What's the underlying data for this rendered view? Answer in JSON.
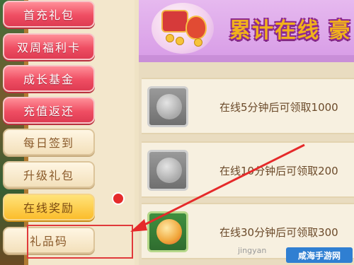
{
  "menu": {
    "items": [
      {
        "label": "首充礼包",
        "style": "pink"
      },
      {
        "label": "双周福利卡",
        "style": "pink"
      },
      {
        "label": "成长基金",
        "style": "pink"
      },
      {
        "label": "充值返还",
        "style": "pink"
      },
      {
        "label": "每日签到",
        "style": "beige"
      },
      {
        "label": "升级礼包",
        "style": "beige"
      },
      {
        "label": "在线奖励",
        "style": "yellow"
      },
      {
        "label": "礼品码",
        "style": "beige"
      }
    ]
  },
  "banner": {
    "title": "累计在线 豪"
  },
  "rewards": [
    {
      "text": "在线5分钟后可领取1000",
      "icon": "grey-locked-reward-icon"
    },
    {
      "text": "在线10分钟后可领取200",
      "icon": "grey-locked-reward-icon"
    },
    {
      "text": "在线30分钟后可领取300",
      "icon": "gold-reward-icon"
    }
  ],
  "watermark": {
    "left": "jingyan",
    "right": "咸海手游网"
  },
  "colors": {
    "pink_button": "#ef4e63",
    "beige_button": "#f3e0bb",
    "yellow_button": "#fbbd2c",
    "highlight": "#e0393a",
    "banner_title": "#f1b21b"
  }
}
